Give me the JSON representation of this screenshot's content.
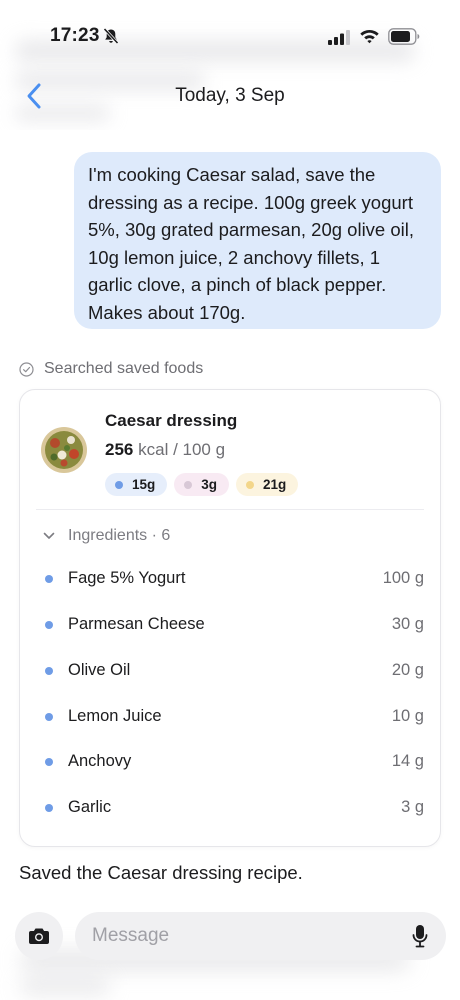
{
  "status_bar": {
    "time": "17:23"
  },
  "header": {
    "title": "Today, 3 Sep"
  },
  "user_message": {
    "text": "I'm cooking Caesar salad, save the dressing as a recipe. 100g greek yogurt 5%, 30g grated parmesan, 20g olive oil, 10g lemon juice, 2 anchovy fillets, 1 garlic clove, a pinch of black pepper. Makes about 170g."
  },
  "tool_status": {
    "label": "Searched saved foods"
  },
  "food_card": {
    "name": "Caesar dressing",
    "kcal": "256",
    "kcal_unit": "kcal / 100 g",
    "macros": [
      {
        "value": "15g",
        "dot_color": "#6f9ce6",
        "bg_color": "#e6eefb"
      },
      {
        "value": "3g",
        "dot_color": "#d8c8d6",
        "bg_color": "#f8eaf3"
      },
      {
        "value": "21g",
        "dot_color": "#f3d68a",
        "bg_color": "#fcf4df"
      }
    ],
    "ingredients_label": "Ingredients · 6",
    "ingredients": [
      {
        "name": "Fage 5% Yogurt",
        "amount": "100 g"
      },
      {
        "name": "Parmesan Cheese",
        "amount": "30 g"
      },
      {
        "name": "Olive Oil",
        "amount": "20 g"
      },
      {
        "name": "Lemon Juice",
        "amount": "10 g"
      },
      {
        "name": "Anchovy",
        "amount": "14 g"
      },
      {
        "name": "Garlic",
        "amount": "3 g"
      }
    ]
  },
  "assistant_message": {
    "text": "Saved the Caesar dressing recipe."
  },
  "composer": {
    "placeholder": "Message"
  },
  "icons": {
    "bell": "bell-slash-icon",
    "signal": "signal-icon",
    "wifi": "wifi-icon",
    "battery": "battery-icon",
    "back": "chevron-left-icon",
    "check": "check-circle-icon",
    "chevron": "chevron-down-icon",
    "camera": "camera-icon",
    "mic": "mic-icon"
  },
  "colors": {
    "accent": "#4a8ff0",
    "user_bubble": "#deeafb",
    "ingredient_dot": "#6f9ce6"
  }
}
